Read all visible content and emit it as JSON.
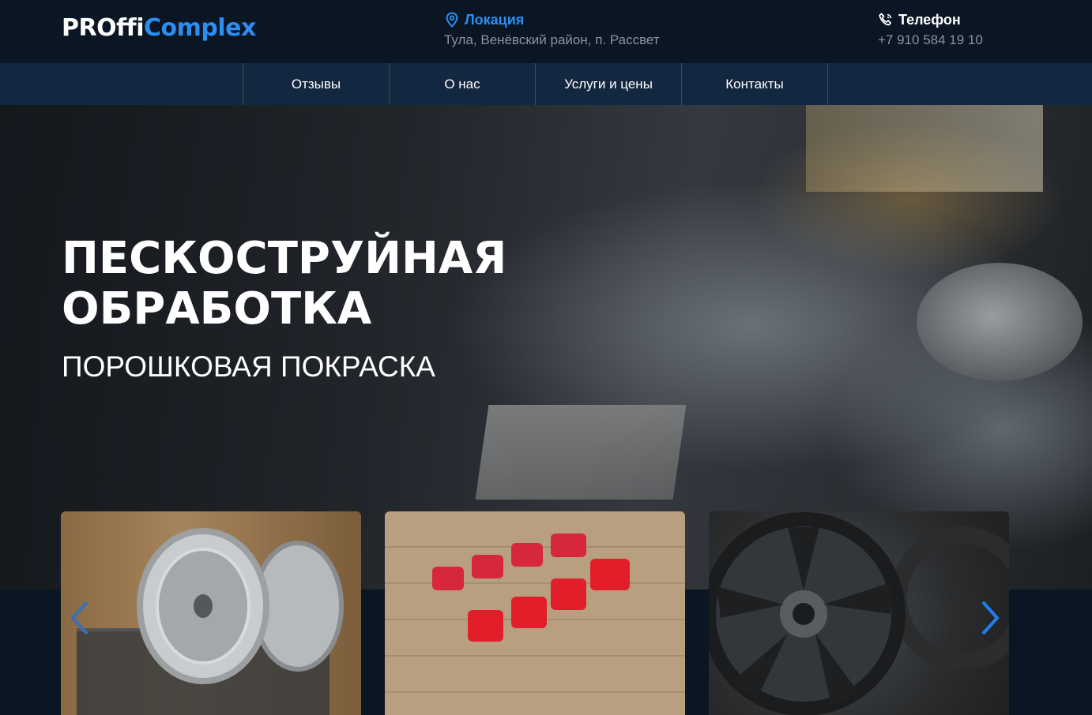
{
  "header": {
    "logo_part1": "PROffi",
    "logo_part2": "Complex",
    "location": {
      "icon": "location-pin-icon",
      "title": "Локация",
      "address": "Тула, Венёвский район, п. Рассвет"
    },
    "phone": {
      "icon": "phone-icon",
      "title": "Телефон",
      "number": "+7 910 584 19 10"
    }
  },
  "nav": {
    "items": [
      {
        "label": "Отзывы"
      },
      {
        "label": "О нас"
      },
      {
        "label": "Услуги и цены"
      },
      {
        "label": "Контакты"
      }
    ]
  },
  "hero": {
    "title": "ПЕСКОСТРУЙНАЯ ОБРАБОТКА",
    "subtitle": "ПОРОШКОВАЯ ПОКРАСКА"
  },
  "gallery": {
    "prev_icon": "chevron-left-icon",
    "next_icon": "chevron-right-icon",
    "photos": [
      "silver-wheel-photo",
      "red-calipers-photo",
      "black-wheel-photo"
    ]
  },
  "colors": {
    "accent": "#2b8ef0",
    "header_bg": "#0b1624",
    "nav_bg": "#142740",
    "muted_text": "#8793a3"
  }
}
